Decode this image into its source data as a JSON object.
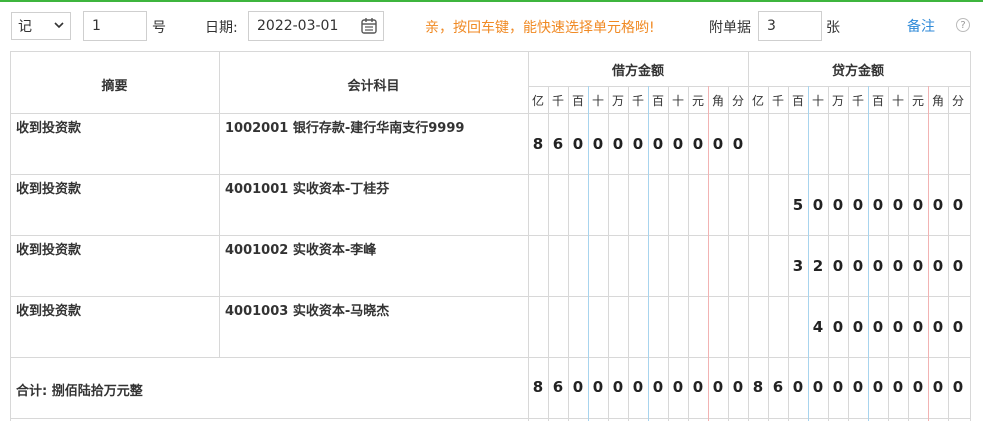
{
  "toolbar": {
    "voucher_word": "记",
    "voucher_number": "1",
    "number_suffix": "号",
    "date_label": "日期:",
    "date_value": "2022-03-01",
    "tip": "亲，按回车键，能快速选择单元格哟!",
    "attach_label": "附单据",
    "attach_count": "3",
    "attach_unit": "张",
    "remark_link": "备注",
    "help": "?"
  },
  "table": {
    "col_summary": "摘要",
    "col_account": "会计科目",
    "col_debit": "借方金额",
    "col_credit": "贷方金额",
    "units": [
      "亿",
      "千",
      "百",
      "十",
      "万",
      "千",
      "百",
      "十",
      "元",
      "角",
      "分"
    ],
    "rows": [
      {
        "summary": "收到投资款",
        "account": "1002001 银行存款-建行华南支行9999",
        "debit": "86000000000",
        "credit": ""
      },
      {
        "summary": "收到投资款",
        "account": "4001001 实收资本-丁桂芬",
        "debit": "",
        "credit": "500000000"
      },
      {
        "summary": "收到投资款",
        "account": "4001002 实收资本-李峰",
        "debit": "",
        "credit": "320000000"
      },
      {
        "summary": "收到投资款",
        "account": "4001003 实收资本-马晓杰",
        "debit": "",
        "credit": "40000000"
      }
    ],
    "total_label": "合计: 捌佰陆拾万元整",
    "total_debit": "86000000000",
    "total_credit": "86000000000"
  },
  "colors": {
    "accent_green": "#3db53d",
    "tip_orange": "#f08a24",
    "link_blue": "#2f8ad8",
    "grid_blue": "#a8d4ee",
    "grid_red": "#f2b3b3"
  },
  "icons": [
    "calendar-icon",
    "chevron-down-icon",
    "help-icon"
  ]
}
